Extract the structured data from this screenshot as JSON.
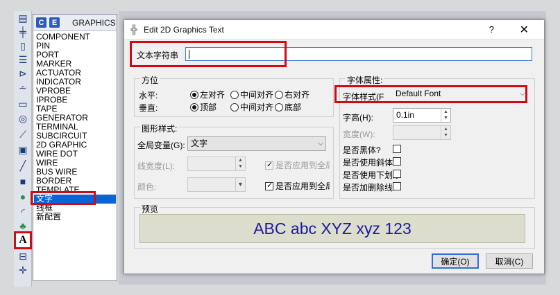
{
  "toolbar": {
    "icons": [
      "grid-icon",
      "pin-icon",
      "component-icon",
      "port-icon",
      "marker-icon",
      "probe-icon",
      "graph-icon",
      "generator-icon",
      "terminal-icon",
      "tape-icon",
      "line-icon",
      "box-icon",
      "circle-icon",
      "arc-icon",
      "path-icon",
      "text-icon",
      "symbol-icon",
      "origin-icon"
    ]
  },
  "objpanel": {
    "btn_c": "C",
    "btn_e": "E",
    "title": "GRAPHICS",
    "items": [
      "COMPONENT",
      "PIN",
      "PORT",
      "MARKER",
      "ACTUATOR",
      "INDICATOR",
      "VPROBE",
      "IPROBE",
      "TAPE",
      "GENERATOR",
      "TERMINAL",
      "SUBCIRCUIT",
      "2D GRAPHIC",
      "WIRE DOT",
      "WIRE",
      "BUS WIRE",
      "BORDER",
      "TEMPLATE",
      "文字",
      "线框",
      "新配置"
    ],
    "selected_index": 18
  },
  "dialog": {
    "title": "Edit 2D Graphics Text",
    "help": "?",
    "close": "✕",
    "text_label": "文本字符串",
    "text_value": "",
    "position": {
      "title": "方位",
      "h_label": "水平:",
      "v_label": "垂直:",
      "h_options": [
        "左对齐",
        "中间对齐",
        "右对齐"
      ],
      "v_options": [
        "顶部",
        "中间对齐",
        "底部"
      ]
    },
    "style": {
      "title": "图形样式:",
      "global_label": "全局变量(G):",
      "global_value": "文字",
      "line_width_label": "线宽度(L):",
      "color_label": "颜色:",
      "apply_global_1": "是否应用到全局",
      "apply_global_2": "是否应用到全局"
    },
    "font": {
      "title": "字体属性:",
      "style_label": "字体样式(F",
      "style_value": "Default Font",
      "height_label": "字高(H):",
      "height_value": "0.1in",
      "width_label": "宽度(W):",
      "bold_label": "是否黑体?",
      "italic_label": "是否使用斜体?",
      "underline_label": "是否使用下划线?",
      "strike_label": "是否加删除线?"
    },
    "preview": {
      "title": "预览",
      "text": "ABC abc XYZ xyz 123"
    },
    "ok": "确定(O)",
    "cancel": "取消(C)"
  }
}
